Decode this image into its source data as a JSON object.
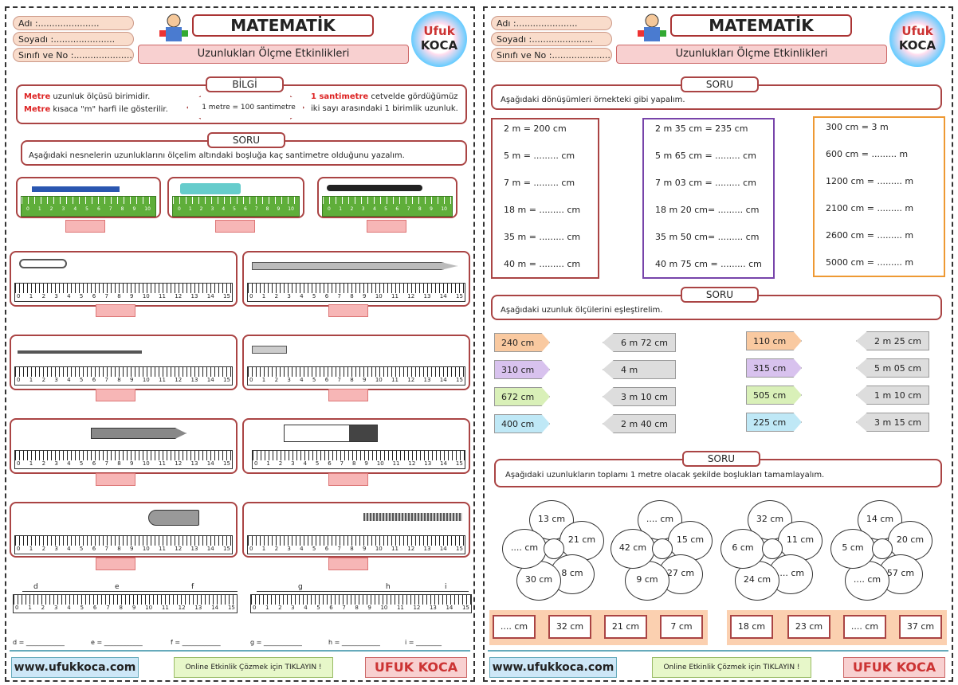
{
  "header": {
    "name": "Adı :",
    "surname": "Soyadı :",
    "class": "Sınıfı ve No :",
    "dots": "......................",
    "title": "MATEMATİK",
    "subtitle": "Uzunlukları Ölçme Etkinlikleri",
    "logo_top": "Ufuk",
    "logo_bottom": "KOCA"
  },
  "left": {
    "info_label": "BİLGİ",
    "info_a1": "Metre",
    "info_a2": " uzunluk ölçüsü birimidir.",
    "info_b1": "Metre",
    "info_b2": " kısaca \"m\" harfi ile gösterilir.",
    "info_arrow": "1 metre = 100 santimetre",
    "info_c1": "1 santimetre",
    "info_c2": " cetvelde gördüğümüz iki sayı arasındaki 1 birimlik uzunluk.",
    "soru_label": "SORU",
    "soru_text": "Aşağıdaki nesnelerin uzunluklarını ölçelim altındaki boşluğa kaç santimetre olduğunu yazalım.",
    "ruler_nums": [
      "0",
      "1",
      "2",
      "3",
      "4",
      "5",
      "6",
      "7",
      "8",
      "9",
      "10",
      "11",
      "12",
      "13",
      "14",
      "15"
    ],
    "cm": "cm",
    "seg_labels": [
      "d",
      "e",
      "f",
      "g",
      "h",
      "i"
    ],
    "answers": [
      "d =",
      "e =",
      "f =",
      "g =",
      "h =",
      "i ="
    ]
  },
  "right": {
    "soru_label": "SORU",
    "soru1": "Aşağıdaki dönüşümleri örnekteki gibi yapalım.",
    "col1": [
      "2 m = 200 cm",
      "5 m = ......... cm",
      "7 m = ......... cm",
      "18 m = ......... cm",
      "35 m = ......... cm",
      "40 m = ......... cm"
    ],
    "col2": [
      "2 m 35 cm = 235 cm",
      "5 m 65 cm = ......... cm",
      "7 m 03 cm = ......... cm",
      "18 m 20 cm= ......... cm",
      "35 m 50 cm= ......... cm",
      "40 m 75 cm = ......... cm"
    ],
    "col3": [
      "300 cm = 3 m",
      "600 cm = ......... m",
      "1200 cm = ......... m",
      "2100 cm = ......... m",
      "2600 cm = ......... m",
      "5000 cm = ......... m"
    ],
    "soru2": "Aşağıdaki uzunluk ölçülerini eşleştirelim.",
    "pills_a": [
      "240 cm",
      "310 cm",
      "672 cm",
      "400 cm"
    ],
    "pills_b": [
      "6 m 72 cm",
      "4 m",
      "3 m 10 cm",
      "2 m 40 cm"
    ],
    "pills_c": [
      "110 cm",
      "315 cm",
      "505 cm",
      "225 cm"
    ],
    "pills_d": [
      "2 m 25 cm",
      "5 m 05 cm",
      "1 m 10 cm",
      "3 m 15 cm"
    ],
    "soru3": "Aşağıdaki uzunlukların toplamı 1 metre olacak şekilde boşlukları tamamlayalım.",
    "flowers": [
      [
        "13 cm",
        "21 cm",
        "8 cm",
        "30 cm",
        ".... cm"
      ],
      [
        ".... cm",
        "15 cm",
        "27 cm",
        "9 cm",
        "42 cm"
      ],
      [
        "32 cm",
        "11 cm",
        ".... cm",
        "24 cm",
        "6 cm"
      ],
      [
        "14 cm",
        "20 cm",
        "57 cm",
        ".... cm",
        "5 cm"
      ]
    ],
    "bottom": [
      ".... cm",
      "32 cm",
      "21 cm",
      "7 cm",
      "18 cm",
      "23 cm",
      ".... cm",
      "37 cm"
    ]
  },
  "footer": {
    "web": "www.ufukkoca.com",
    "mid": "Online Etkinlik Çözmek için TIKLAYIN !",
    "name": "UFUK KOCA"
  }
}
